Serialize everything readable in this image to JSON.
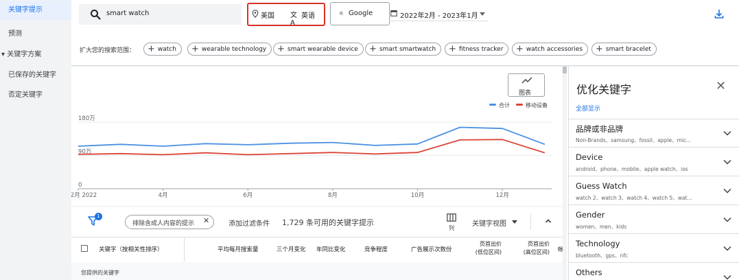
{
  "nav": {
    "items": [
      {
        "label": "关键字提示",
        "active": true
      },
      {
        "label": "预测"
      },
      {
        "label": "关键字方案",
        "expand": "▾"
      },
      {
        "label": "已保存的关键字"
      },
      {
        "label": "否定关键字"
      }
    ]
  },
  "search": {
    "query": "smart watch"
  },
  "targeting": {
    "location": "美国",
    "language": "英语",
    "network": "Google",
    "date_range": "2022年2月 - 2023年1月"
  },
  "expand": {
    "label": "扩大您的搜索范围：",
    "chips": [
      "watch",
      "wearable technology",
      "smart wearable device",
      "smart smartwatch",
      "fitness tracker",
      "watch accessories",
      "smart bracelet"
    ]
  },
  "chart_btn": {
    "label": "图表"
  },
  "chart_data": {
    "type": "line",
    "x_ticks": [
      "2月 2022",
      "4月",
      "6月",
      "8月",
      "10月",
      "12月"
    ],
    "categories": [
      "2022-02",
      "2022-03",
      "2022-04",
      "2022-05",
      "2022-06",
      "2022-07",
      "2022-08",
      "2022-09",
      "2022-10",
      "2022-11",
      "2022-12",
      "2023-01"
    ],
    "y_ticks": [
      "0",
      "90万",
      "180万"
    ],
    "y_values": [
      0,
      900000,
      1800000
    ],
    "ylim": [
      0,
      1800000
    ],
    "series": [
      {
        "name": "合计",
        "color": "#4a90e2",
        "values": [
          1150000,
          1200000,
          1150000,
          1220000,
          1190000,
          1230000,
          1250000,
          1170000,
          1210000,
          1660000,
          1630000,
          1200000
        ]
      },
      {
        "name": "移动设备",
        "color": "#db4437",
        "values": [
          930000,
          950000,
          920000,
          970000,
          920000,
          950000,
          980000,
          940000,
          980000,
          1320000,
          1330000,
          970000
        ]
      }
    ]
  },
  "filter": {
    "badge": "1",
    "adult_chip": "排除含成人内容的提示",
    "add_filter": "添加过滤条件",
    "count_text": "1,729 条可用的关键字提示",
    "cols_label": "列",
    "view_label": "关键字视图"
  },
  "table": {
    "headers": [
      {
        "l1": "关键字（按相关性排序）"
      },
      {
        "l1": "平均每月搜索量"
      },
      {
        "l1": "三个月变化"
      },
      {
        "l1": "年同比变化"
      },
      {
        "l1": "竞争程度"
      },
      {
        "l1": "广告展示次数份"
      },
      {
        "l1": "页首出价",
        "l2": "(低位区间)"
      },
      {
        "l1": "页首出价",
        "l2": "(高位区间)"
      },
      {
        "l1": "帐"
      }
    ],
    "provided_label": "您提供的关键字"
  },
  "panel": {
    "title": "优化关键字",
    "show_all": "全部显示",
    "groups": [
      {
        "title": "品牌或非品牌",
        "sub": "Non-Brands、samsung、fossil、apple、mic..."
      },
      {
        "title": "Device",
        "sub": "android、phone、mobile、apple watch、ios"
      },
      {
        "title": "Guess Watch",
        "sub": "watch 2、watch 3、watch 4、watch 5、wat..."
      },
      {
        "title": "Gender",
        "sub": "women、men、kids"
      },
      {
        "title": "Technology",
        "sub": "bluetooth、gps、nfc"
      },
      {
        "title": "Others",
        "sub": ""
      }
    ]
  }
}
